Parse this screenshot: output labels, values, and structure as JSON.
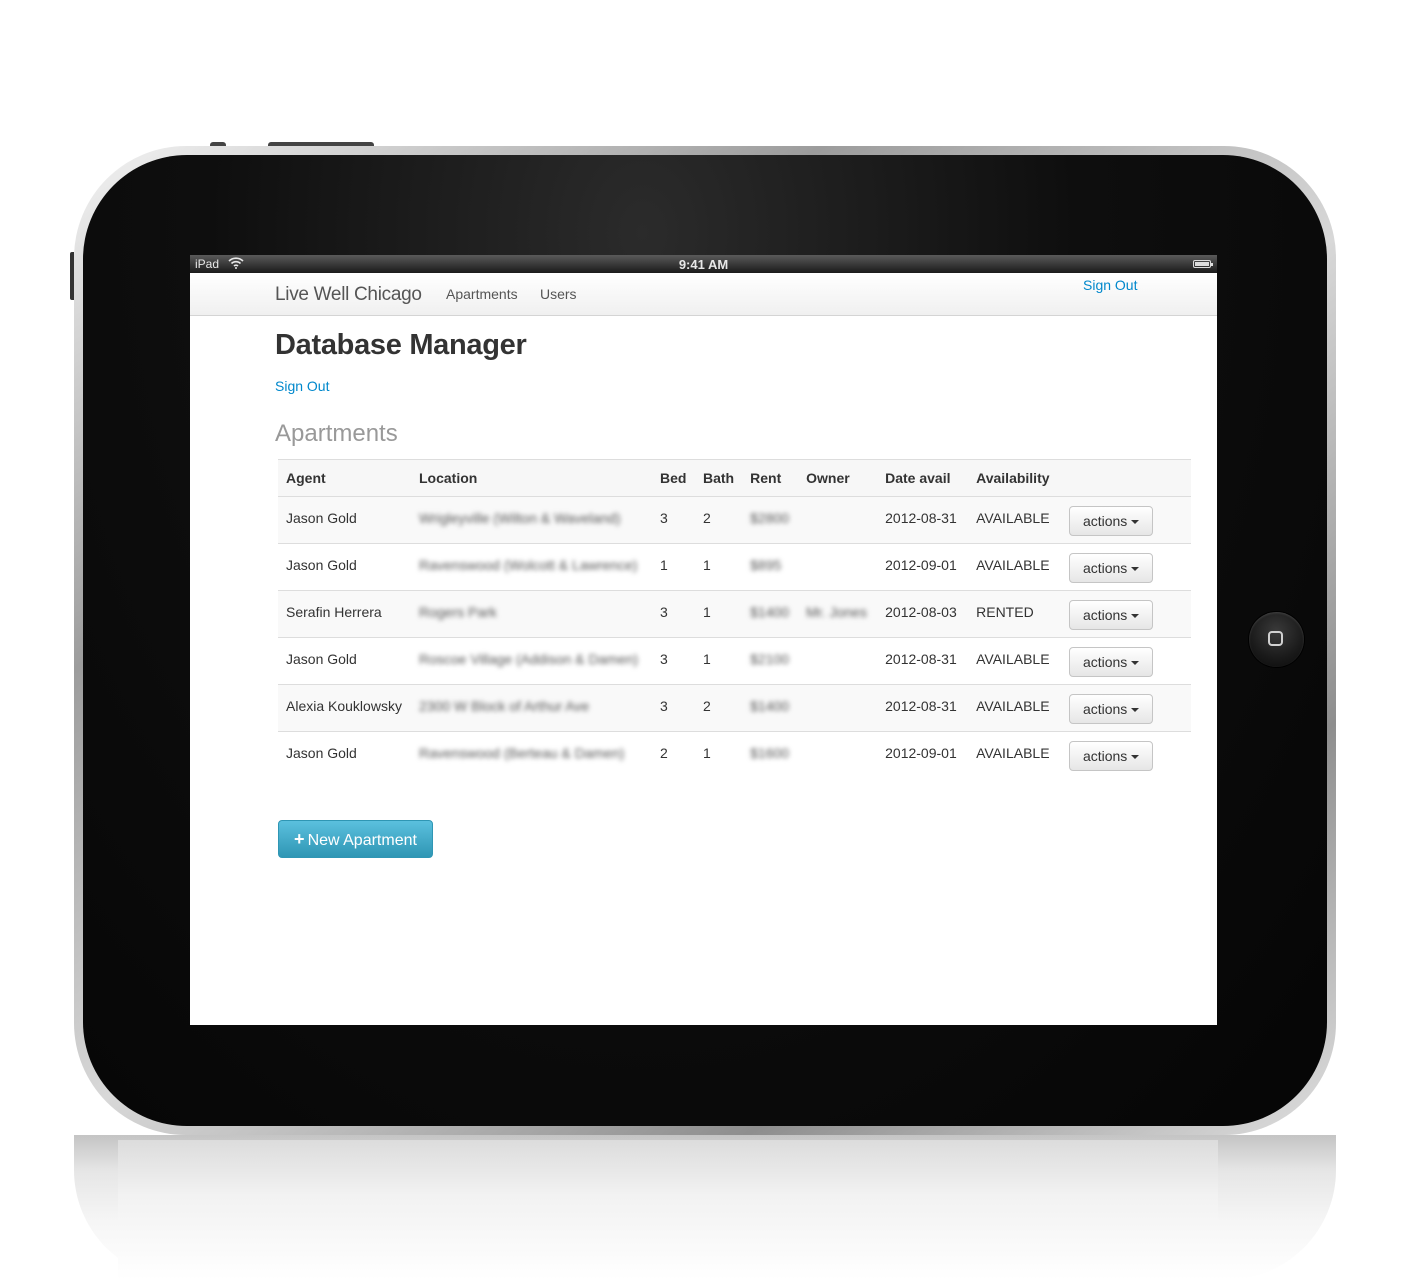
{
  "status_bar": {
    "device": "iPad",
    "time": "9:41 AM"
  },
  "navbar": {
    "brand": "Live Well Chicago",
    "items": [
      "Apartments",
      "Users"
    ],
    "sign_out": "Sign Out"
  },
  "page": {
    "title": "Database Manager",
    "sign_out": "Sign Out",
    "section_title": "Apartments"
  },
  "table": {
    "headers": [
      "Agent",
      "Location",
      "Bed",
      "Bath",
      "Rent",
      "Owner",
      "Date avail",
      "Availability",
      ""
    ],
    "action_label": "actions",
    "rows": [
      {
        "agent": "Jason Gold",
        "location": "Wrigleyville (Wilton & Waveland)",
        "bed": "3",
        "bath": "2",
        "rent": "$2800",
        "owner": "",
        "date": "2012-08-31",
        "availability": "AVAILABLE"
      },
      {
        "agent": "Jason Gold",
        "location": "Ravenswood (Wolcott & Lawrence)",
        "bed": "1",
        "bath": "1",
        "rent": "$895",
        "owner": "",
        "date": "2012-09-01",
        "availability": "AVAILABLE"
      },
      {
        "agent": "Serafin Herrera",
        "location": "Rogers Park",
        "bed": "3",
        "bath": "1",
        "rent": "$1400",
        "owner": "Mr. Jones",
        "date": "2012-08-03",
        "availability": "RENTED"
      },
      {
        "agent": "Jason Gold",
        "location": "Roscoe Village (Addison & Damen)",
        "bed": "3",
        "bath": "1",
        "rent": "$2100",
        "owner": "",
        "date": "2012-08-31",
        "availability": "AVAILABLE"
      },
      {
        "agent": "Alexia Kouklowsky",
        "location": "2300 W Block of Arthur Ave",
        "bed": "3",
        "bath": "2",
        "rent": "$1400",
        "owner": "",
        "date": "2012-08-31",
        "availability": "AVAILABLE"
      },
      {
        "agent": "Jason Gold",
        "location": "Ravenswood (Berteau & Damen)",
        "bed": "2",
        "bath": "1",
        "rent": "$1600",
        "owner": "",
        "date": "2012-09-01",
        "availability": "AVAILABLE"
      }
    ]
  },
  "new_button": {
    "icon": "plus-icon",
    "label": "New Apartment"
  },
  "colors": {
    "link": "#0088cc",
    "button_info": "#49afcd",
    "title": "#333333",
    "muted": "#999999"
  }
}
